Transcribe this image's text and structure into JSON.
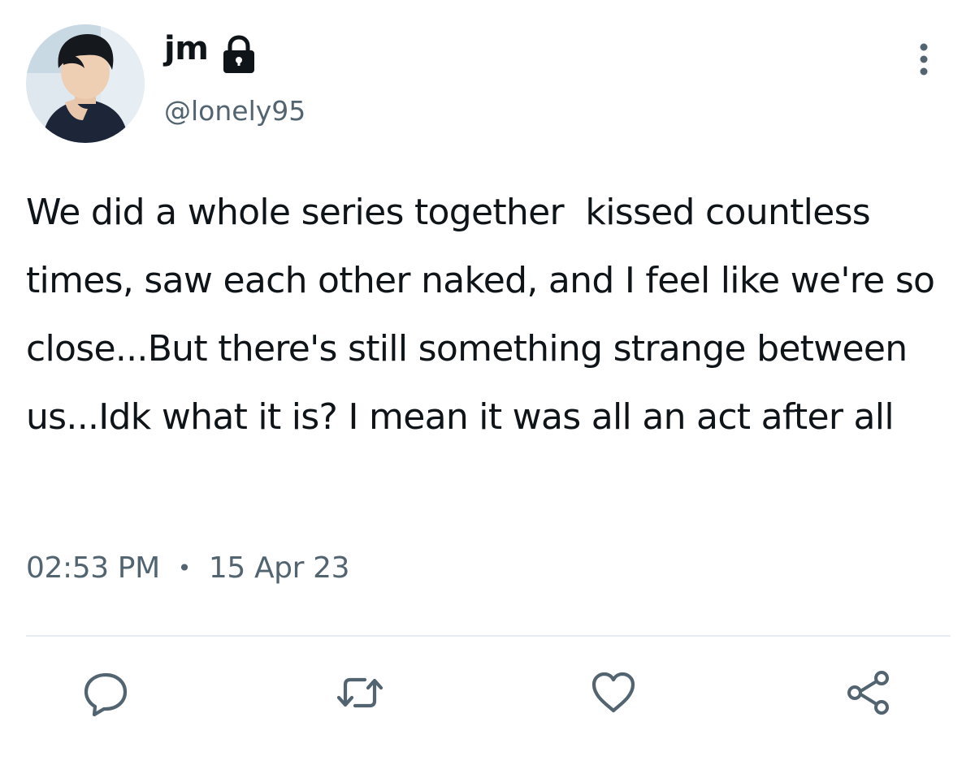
{
  "tweet": {
    "display_name": "jm",
    "handle": "@lonely95",
    "text": "We did a whole series together  kissed countless times, saw each other naked, and I feel like we're so close...But there's still something strange between us...Idk what it is? I mean it was all an act after all",
    "time": "02:53 PM",
    "separator": "•",
    "date": "15 Apr 23"
  },
  "icons": {
    "protected": "lock-icon",
    "more": "more-options-icon",
    "reply": "reply-icon",
    "retweet": "retweet-icon",
    "like": "like-heart-icon",
    "share": "share-icon"
  },
  "colors": {
    "text": "#0f1419",
    "secondary": "#536471",
    "divider": "#e8ecef"
  }
}
